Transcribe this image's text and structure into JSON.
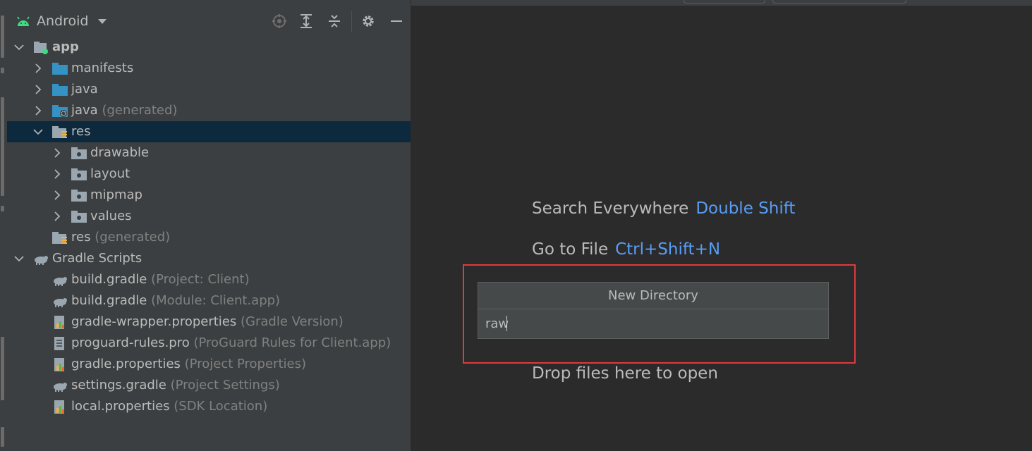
{
  "panel": {
    "view_mode": "Android",
    "icons": [
      "locate-icon",
      "expand-all-icon",
      "collapse-all-icon",
      "gear-icon",
      "minimize-icon"
    ]
  },
  "tree": [
    {
      "name": "app",
      "hint": "",
      "icon": "module-icon",
      "expanded": true,
      "chevron": "down"
    },
    {
      "name": "manifests",
      "hint": "",
      "icon": "folder-icon",
      "chevron": "right"
    },
    {
      "name": "java",
      "hint": "",
      "icon": "folder-icon",
      "chevron": "right"
    },
    {
      "name": "java",
      "hint": "(generated)",
      "icon": "generated-folder-icon",
      "chevron": "right"
    },
    {
      "name": "res",
      "hint": "",
      "icon": "resource-folder-icon",
      "chevron": "down",
      "selected": true
    },
    {
      "name": "drawable",
      "hint": "",
      "icon": "package-folder-icon",
      "chevron": "right"
    },
    {
      "name": "layout",
      "hint": "",
      "icon": "package-folder-icon",
      "chevron": "right"
    },
    {
      "name": "mipmap",
      "hint": "",
      "icon": "package-folder-icon",
      "chevron": "right"
    },
    {
      "name": "values",
      "hint": "",
      "icon": "package-folder-icon",
      "chevron": "right"
    },
    {
      "name": "res",
      "hint": "(generated)",
      "icon": "resource-folder-icon",
      "chevron": "none"
    },
    {
      "name": "Gradle Scripts",
      "hint": "",
      "icon": "gradle-elephant-icon",
      "chevron": "down"
    },
    {
      "name": "build.gradle",
      "hint": "(Project: Client)",
      "icon": "gradle-elephant-icon",
      "chevron": "none"
    },
    {
      "name": "build.gradle",
      "hint": "(Module: Client.app)",
      "icon": "gradle-elephant-icon",
      "chevron": "none"
    },
    {
      "name": "gradle-wrapper.properties",
      "hint": "(Gradle Version)",
      "icon": "properties-file-icon",
      "chevron": "none"
    },
    {
      "name": "proguard-rules.pro",
      "hint": "(ProGuard Rules for Client.app)",
      "icon": "text-file-icon",
      "chevron": "none"
    },
    {
      "name": "gradle.properties",
      "hint": "(Project Properties)",
      "icon": "properties-file-icon",
      "chevron": "none"
    },
    {
      "name": "settings.gradle",
      "hint": "(Project Settings)",
      "icon": "gradle-elephant-icon",
      "chevron": "none"
    },
    {
      "name": "local.properties",
      "hint": "(SDK Location)",
      "icon": "properties-file-icon",
      "chevron": "none"
    }
  ],
  "editor": {
    "search_label": "Search Everywhere",
    "search_shortcut": "Double Shift",
    "goto_label": "Go to File",
    "goto_shortcut": "Ctrl+Shift+N",
    "drop_label": "Drop files here to open"
  },
  "new_directory_popup": {
    "title": "New Directory",
    "input_value": "raw"
  },
  "colors": {
    "panel_bg": "#3c3f41",
    "editor_bg": "#2b2b2b",
    "selection": "#0d293e",
    "shortcut": "#589df6",
    "highlight_box": "#e0393e",
    "folder": "#3592c4"
  }
}
